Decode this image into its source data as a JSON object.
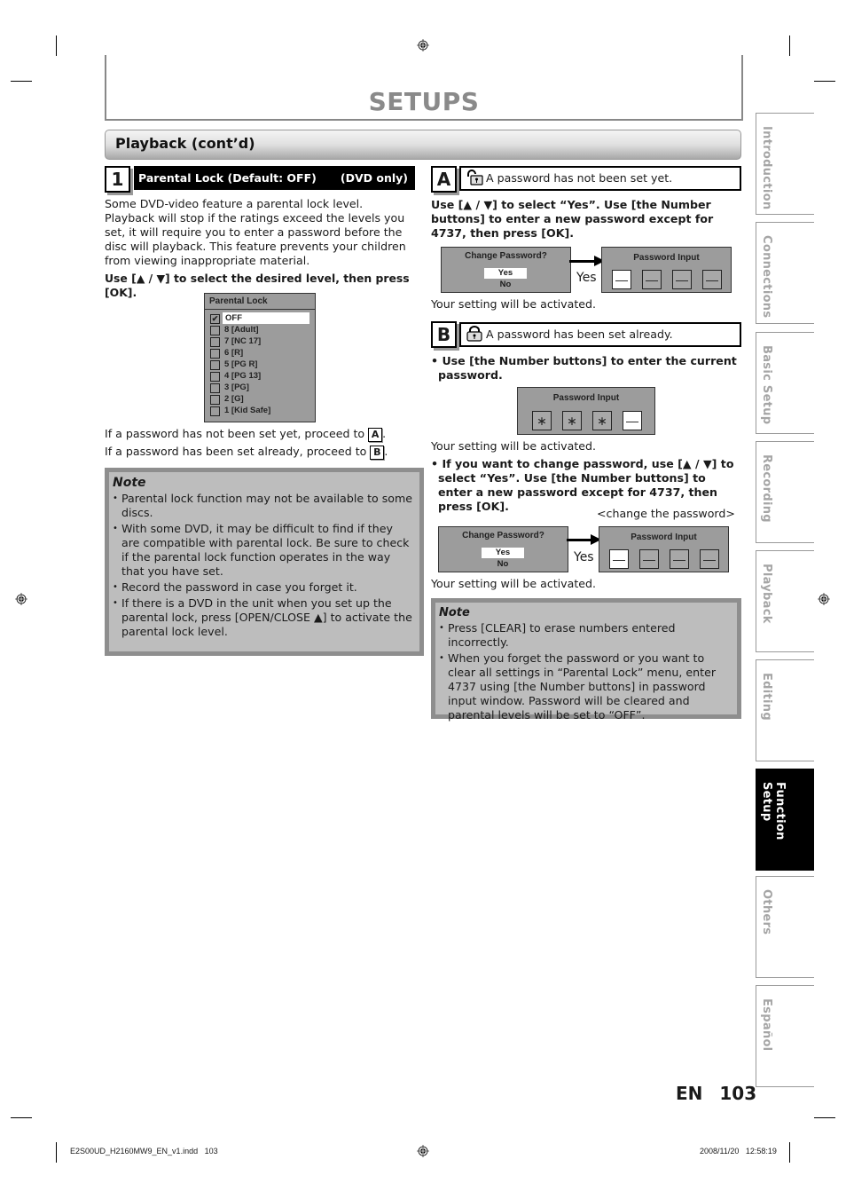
{
  "page": {
    "title": "SETUPS",
    "section_title": "Playback (cont’d)",
    "page_lang": "EN",
    "page_number": "103"
  },
  "step1": {
    "number": "1",
    "heading": "Parental Lock (Default: OFF)",
    "scope": "(DVD only)",
    "description": "Some DVD-video feature a parental lock level. Playback will stop if the ratings exceed the levels you set, it will require you to enter a password before the disc will playback. This feature prevents your children from viewing inappropriate material.",
    "instruction": "Use [▲ / ▼] to select the desired level, then press [OK].",
    "menu": {
      "title": "Parental Lock",
      "items": [
        {
          "label": "OFF",
          "checked": true,
          "selected": true
        },
        {
          "label": "8 [Adult]",
          "checked": false,
          "selected": false
        },
        {
          "label": "7 [NC 17]",
          "checked": false,
          "selected": false
        },
        {
          "label": "6 [R]",
          "checked": false,
          "selected": false
        },
        {
          "label": "5 [PG R]",
          "checked": false,
          "selected": false
        },
        {
          "label": "4 [PG 13]",
          "checked": false,
          "selected": false
        },
        {
          "label": "3 [PG]",
          "checked": false,
          "selected": false
        },
        {
          "label": "2 [G]",
          "checked": false,
          "selected": false
        },
        {
          "label": "1 [Kid Safe]",
          "checked": false,
          "selected": false
        }
      ]
    },
    "proceed_a": "If a password has not been set yet, proceed to",
    "proceed_a_letter": "A",
    "proceed_b": "If a password has been set already, proceed to",
    "proceed_b_letter": "B",
    "note": {
      "title": "Note",
      "items": [
        "Parental lock function may not be available to some discs.",
        "With some DVD, it may be difficult to find if they are compatible with parental lock. Be sure to check if the parental lock function operates in the way that you have set.",
        "Record the password in case you forget it.",
        "If there is a DVD in the unit when you set up the parental lock, press [OPEN/CLOSE ▲] to activate the parental lock level."
      ]
    }
  },
  "caseA": {
    "letter": "A",
    "icon": "unlocked-padlock-icon",
    "condition": "A password has not been set yet.",
    "instruction": "Use [▲ / ▼] to select “Yes”. Use [the Number buttons] to enter a new password except for 4737, then press [OK].",
    "dialog": {
      "title": "Change Password?",
      "options": [
        "Yes",
        "No"
      ],
      "selected": "Yes"
    },
    "arrow_label": "Yes",
    "pw_dialog": {
      "title": "Password Input",
      "cells": [
        "—",
        "—",
        "—",
        "—"
      ],
      "active_index": 0
    },
    "result": "Your setting will be activated."
  },
  "caseB": {
    "letter": "B",
    "icon": "locked-padlock-icon",
    "condition": "A password has been set already.",
    "instruction1": "Use [the Number buttons] to enter the current password.",
    "pw_dialog1": {
      "title": "Password Input",
      "cells": [
        "∗",
        "∗",
        "∗",
        "—"
      ],
      "active_index": 3
    },
    "result1": "Your setting will be activated.",
    "instruction2": "If you want to change password, use [▲ / ▼] to select “Yes”. Use [the Number buttons] to enter a new password except for 4737, then press [OK].",
    "change_caption": "<change the password>",
    "dialog": {
      "title": "Change Password?",
      "options": [
        "Yes",
        "No"
      ],
      "selected": "Yes"
    },
    "arrow_label": "Yes",
    "pw_dialog2": {
      "title": "Password Input",
      "cells": [
        "—",
        "—",
        "—",
        "—"
      ],
      "active_index": 0
    },
    "result2": "Your setting will be activated.",
    "note": {
      "title": "Note",
      "items": [
        "Press [CLEAR] to erase numbers entered incorrectly.",
        "When you forget the password or you want to clear all settings in “Parental Lock” menu, enter 4737 using [the Number buttons] in password input window. Password will be cleared and parental levels will be set to “OFF”."
      ]
    }
  },
  "side_tabs": [
    {
      "label": "Introduction",
      "active": false
    },
    {
      "label": "Connections",
      "active": false
    },
    {
      "label": "Basic Setup",
      "active": false
    },
    {
      "label": "Recording",
      "active": false
    },
    {
      "label": "Playback",
      "active": false
    },
    {
      "label": "Editing",
      "active": false
    },
    {
      "label": "Function Setup",
      "active": true
    },
    {
      "label": "Others",
      "active": false
    },
    {
      "label": "Español",
      "active": false
    }
  ],
  "footer": {
    "file": "E2S00UD_H2160MW9_EN_v1.indd   103",
    "timestamp": "2008/11/20   12:58:19"
  }
}
